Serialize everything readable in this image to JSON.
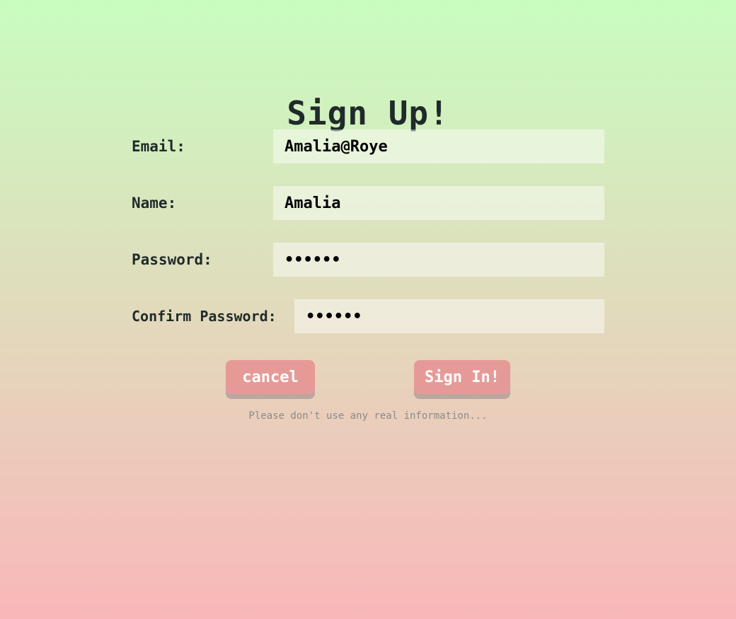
{
  "title": "Sign Up!",
  "form": {
    "email": {
      "label": "Email:",
      "value": "Amalia@Roye"
    },
    "name": {
      "label": "Name:",
      "value": "Amalia"
    },
    "password": {
      "label": "Password:",
      "value": "••••••"
    },
    "confirm_password": {
      "label": "Confirm Password:",
      "value": "••••••"
    }
  },
  "buttons": {
    "cancel_label": "cancel",
    "signin_label": "Sign In!"
  },
  "disclaimer": "Please don't use any real information...",
  "colors": {
    "button_bg": "#e69a98",
    "button_shadow": "#bba6a0",
    "gradient_top": "#c8fdbf",
    "gradient_bottom": "#f9b7b9"
  }
}
